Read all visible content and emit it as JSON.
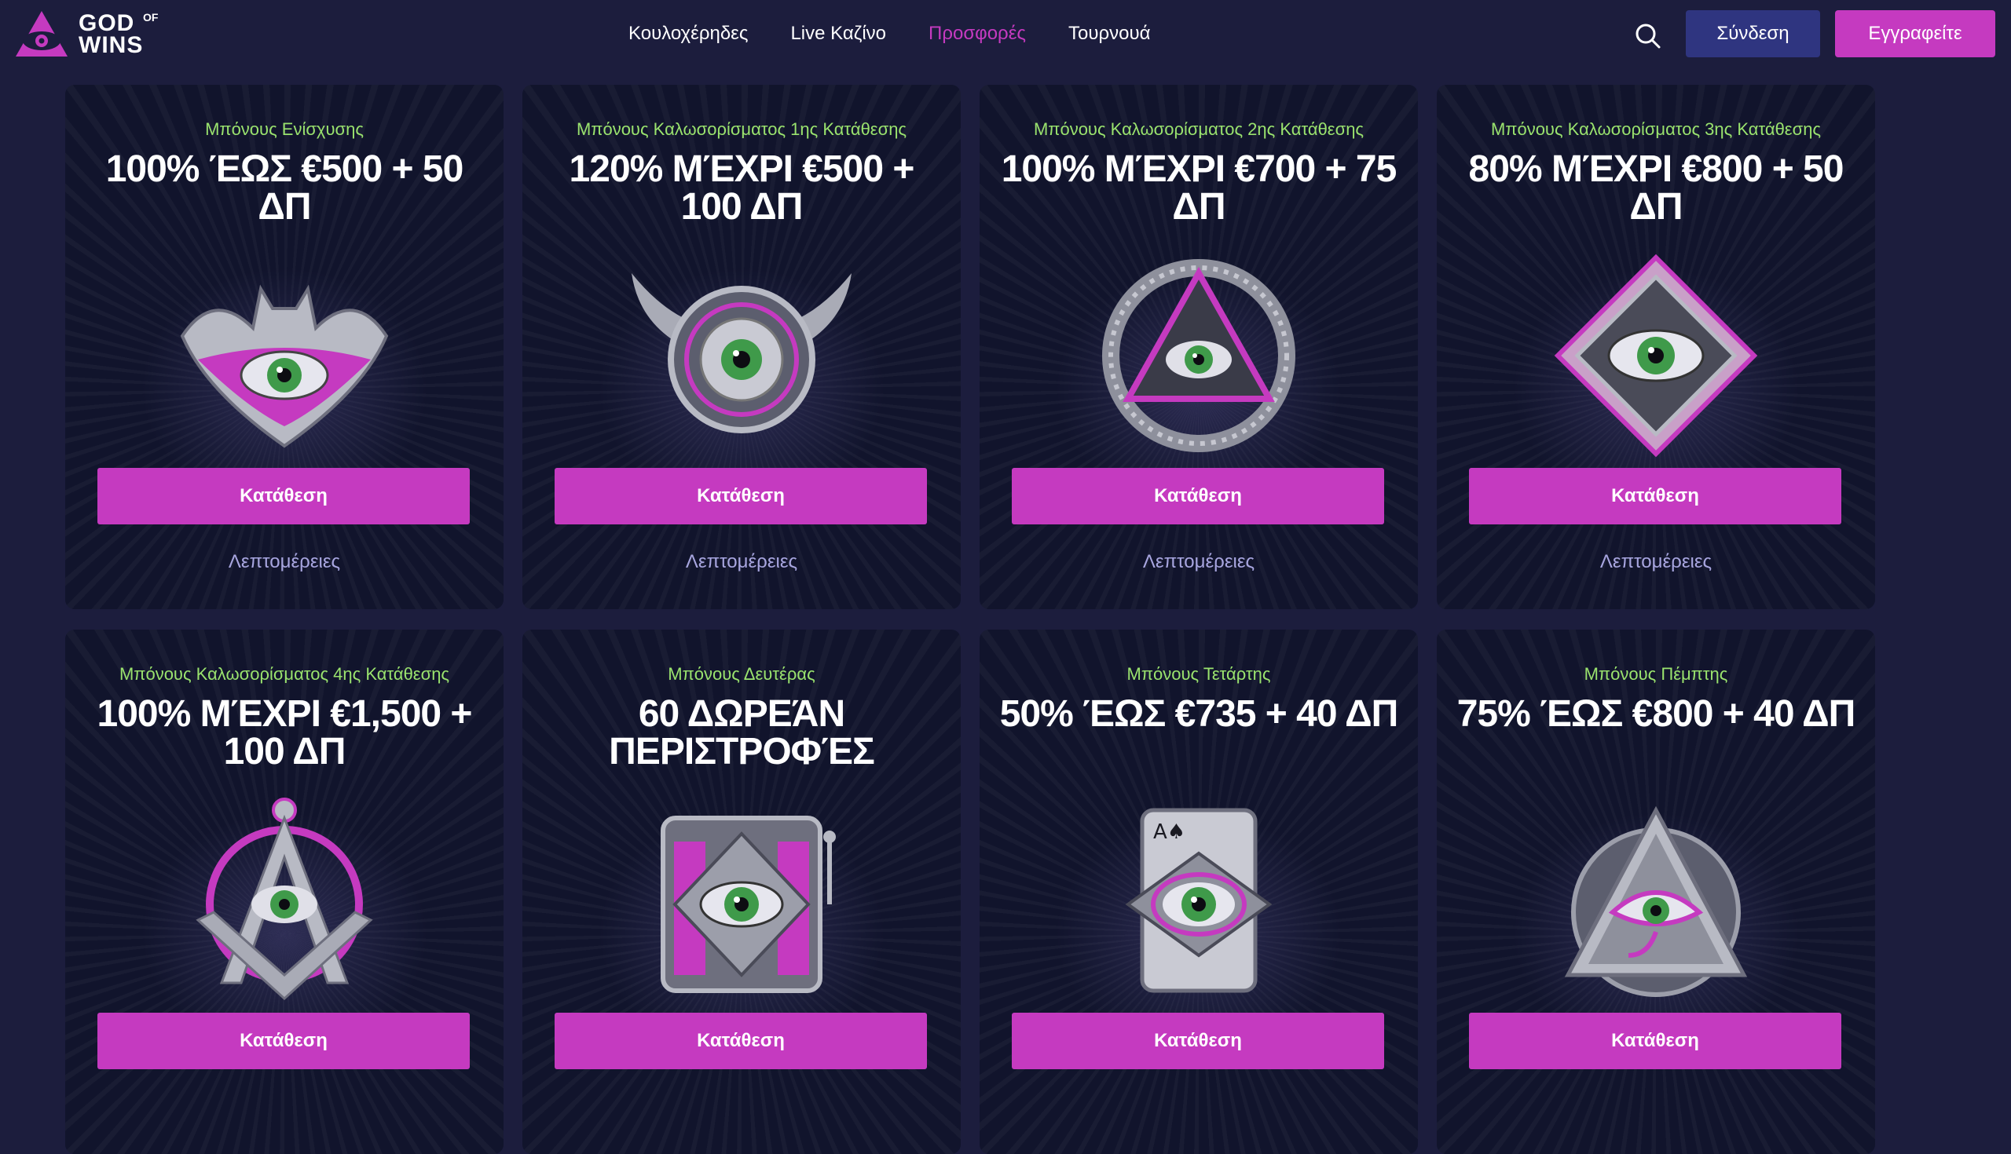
{
  "header": {
    "logo": {
      "god": "GOD",
      "of": "OF",
      "wins": "WINS"
    },
    "nav": [
      {
        "label": "Κουλοχέρηδες",
        "active": false
      },
      {
        "label": "Live Καζίνο",
        "active": false
      },
      {
        "label": "Προσφορές",
        "active": true
      },
      {
        "label": "Τουρνουά",
        "active": false
      }
    ],
    "search_icon": "search-icon",
    "login_label": "Σύνδεση",
    "signup_label": "Εγγραφείτε"
  },
  "colors": {
    "background": "#1c1d3d",
    "card": "#11142c",
    "accent": "#c53ac0",
    "login_button": "#2f3580",
    "bonus_label": "#9ae36e",
    "details_link": "#a8a6e0"
  },
  "cards": [
    {
      "label": "Μπόνους Ενίσχυσης",
      "title": "100% ΈΩΣ €500 + 50 ΔΠ",
      "art": "batman-eye-emblem",
      "button": "Κατάθεση",
      "details": "Λεπτομέρειες"
    },
    {
      "label": "Μπόνους Καλωσορίσματος 1ης Κατάθεσης",
      "title": "120% ΜΈΧΡΙ €500 + 100 ΔΠ",
      "art": "winged-eye-emblem",
      "button": "Κατάθεση",
      "details": "Λεπτομέρειες"
    },
    {
      "label": "Μπόνους Καλωσορίσματος 2ης Κατάθεσης",
      "title": "100% ΜΈΧΡΙ €700 + 75 ΔΠ",
      "art": "snake-pyramid-eye-emblem",
      "button": "Κατάθεση",
      "details": "Λεπτομέρειες"
    },
    {
      "label": "Μπόνους Καλωσορίσματος 3ης Κατάθεσης",
      "title": "80% ΜΈΧΡΙ €800 + 50 ΔΠ",
      "art": "diamond-eye-emblem",
      "button": "Κατάθεση",
      "details": "Λεπτομέρειες"
    },
    {
      "label": "Μπόνους Καλωσορίσματος 4ης Κατάθεσης",
      "title": "100% ΜΈΧΡΙ €1,500 + 100 ΔΠ",
      "art": "compass-square-eye-emblem",
      "button": "Κατάθεση",
      "details": ""
    },
    {
      "label": "Μπόνους Δευτέρας",
      "title": "60 ΔΩΡΕΆΝ ΠΕΡΙΣΤΡΟΦΈΣ",
      "art": "slot-machine-eye-emblem",
      "button": "Κατάθεση",
      "details": ""
    },
    {
      "label": "Μπόνους Τετάρτης",
      "title": "50% ΈΩΣ €735 + 40 ΔΠ",
      "art": "playing-card-eye-emblem",
      "button": "Κατάθεση",
      "details": ""
    },
    {
      "label": "Μπόνους Πέμπτης",
      "title": "75% ΈΩΣ €800 + 40 ΔΠ",
      "art": "pyramid-eye-of-ra-emblem",
      "button": "Κατάθεση",
      "details": ""
    }
  ]
}
